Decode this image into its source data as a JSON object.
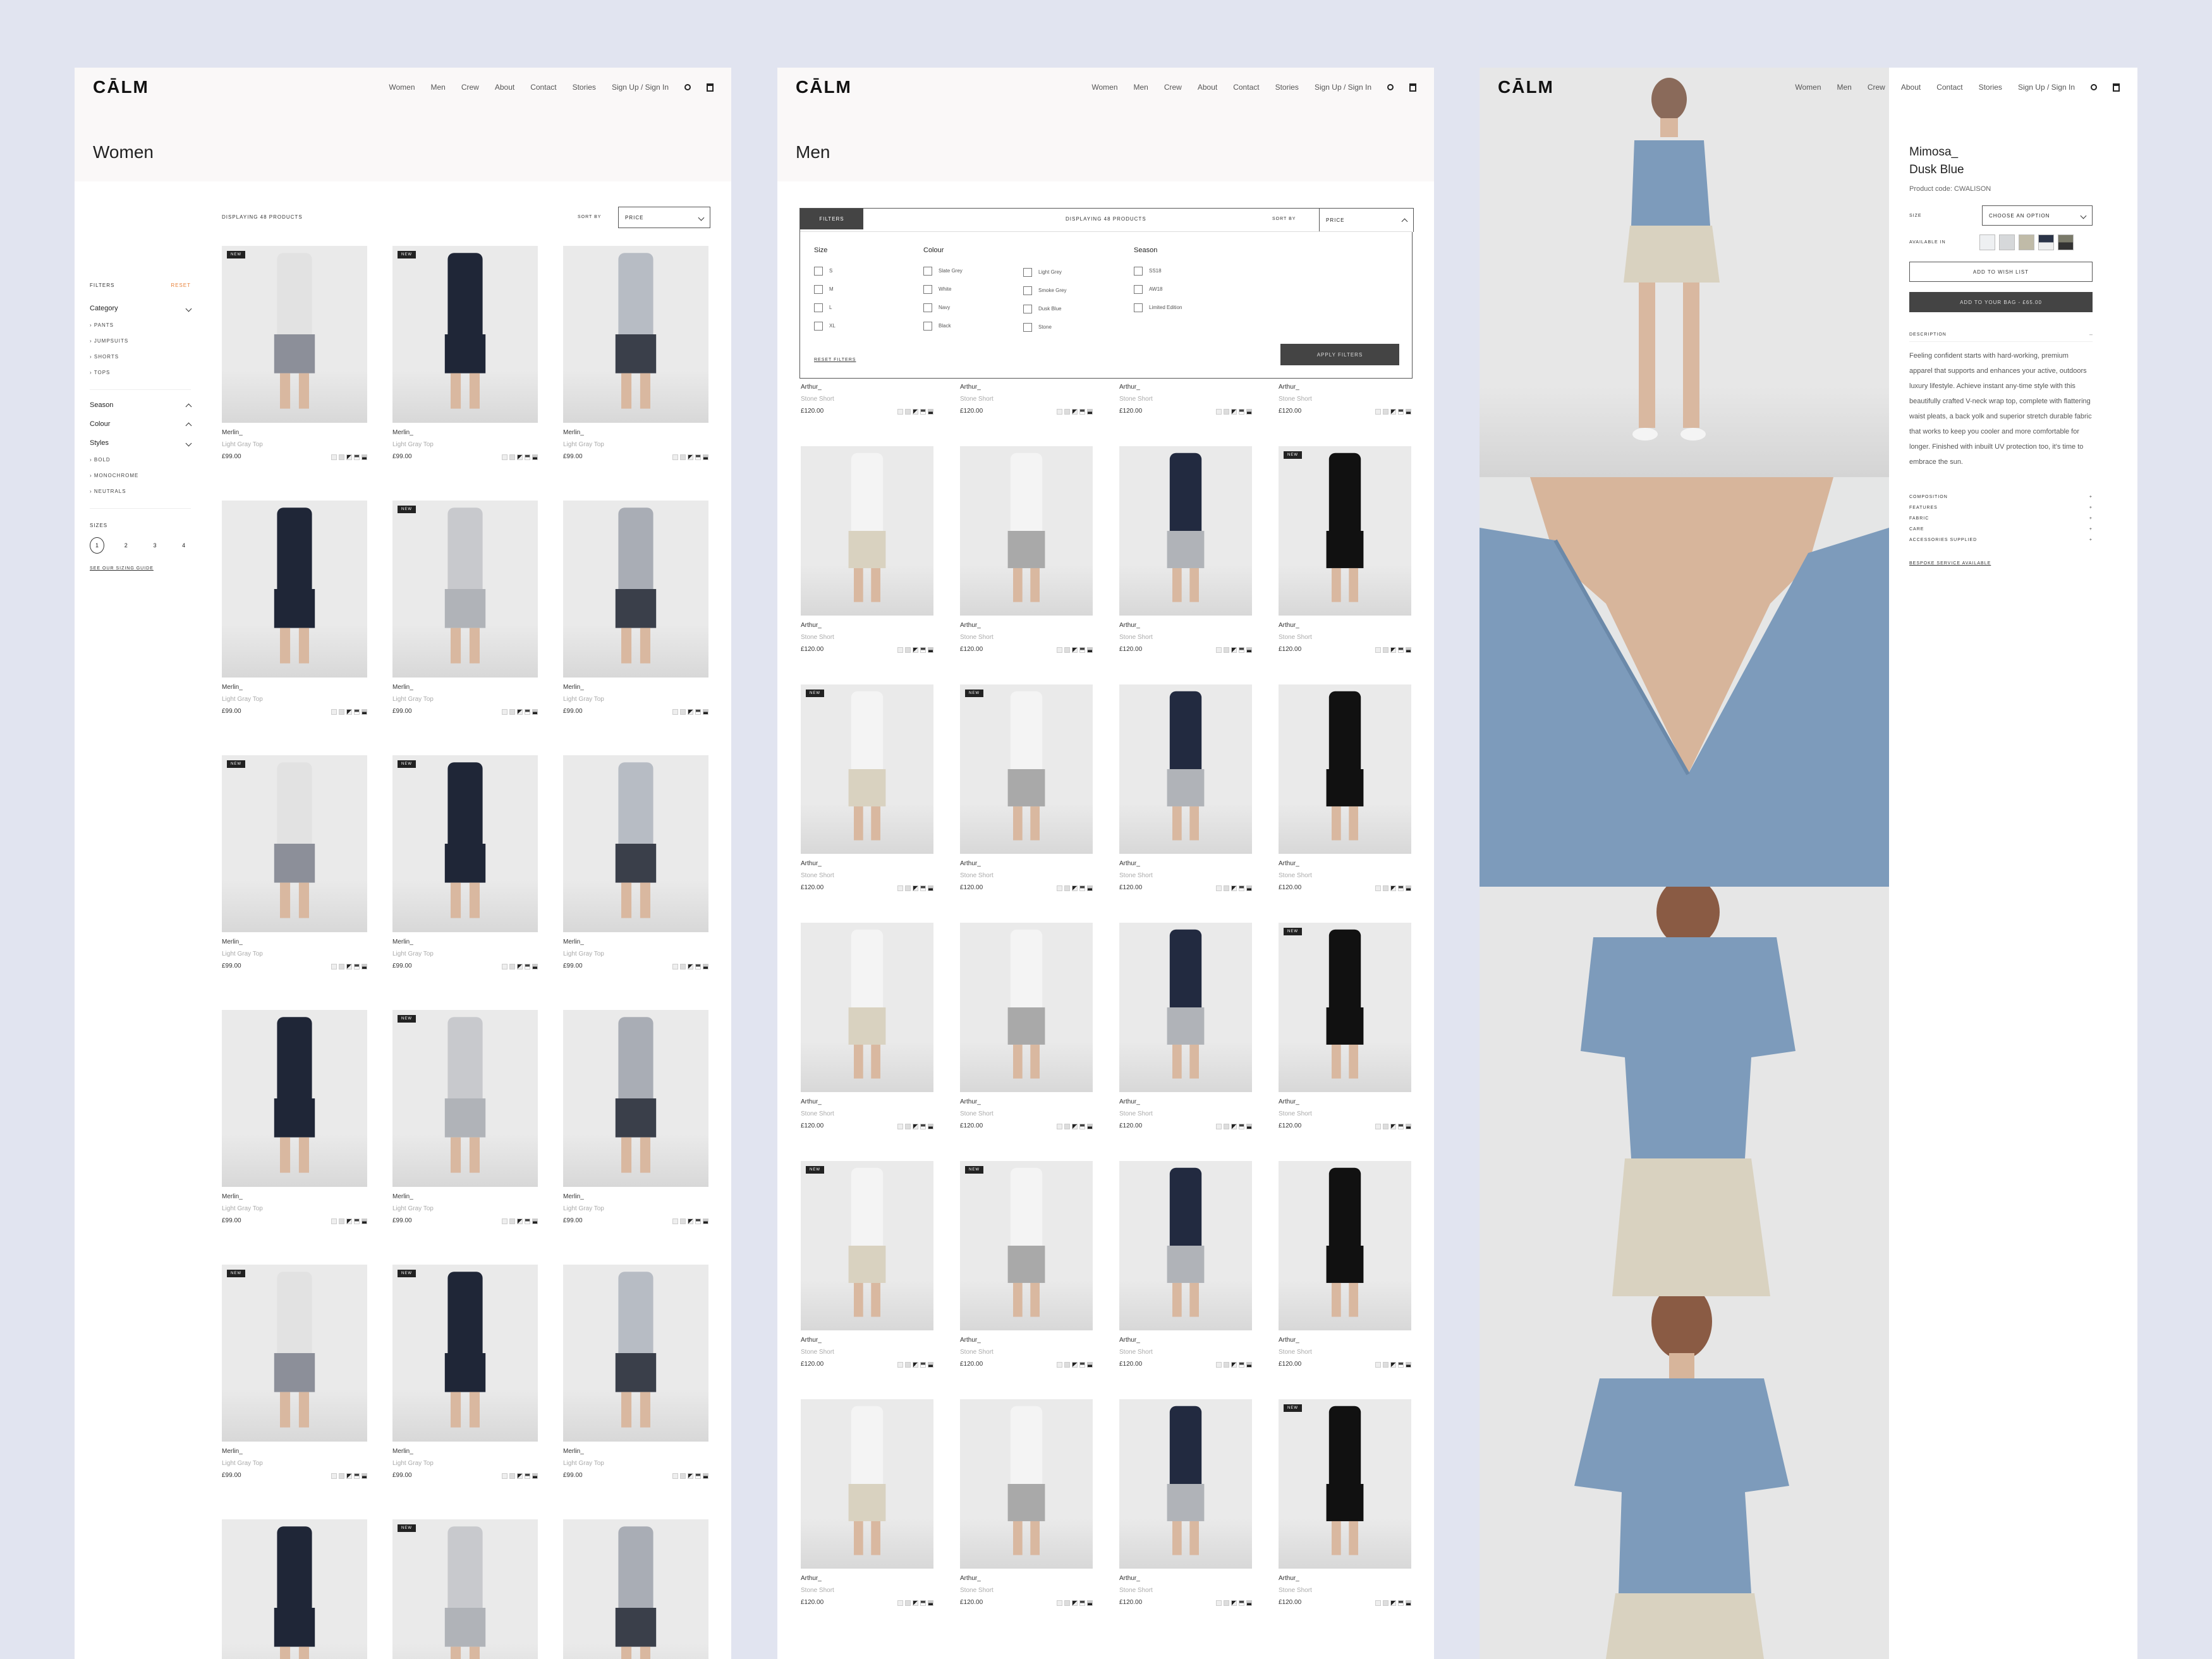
{
  "brand": "CĀLM",
  "nav": [
    "Women",
    "Men",
    "Crew",
    "About",
    "Contact",
    "Stories",
    "Sign Up / Sign In"
  ],
  "women": {
    "title": "Women",
    "filters_label": "FILTERS",
    "reset_label": "RESET",
    "category_label": "Category",
    "categories": [
      "PANTS",
      "JUMPSUITS",
      "SHORTS",
      "TOPS"
    ],
    "season_label": "Season",
    "colour_label": "Colour",
    "styles_label": "Styles",
    "styles": [
      "BOLD",
      "MONOCHROME",
      "NEUTRALS"
    ],
    "sizes_label": "SIZES",
    "sizes": [
      "1",
      "2",
      "3",
      "4"
    ],
    "sizing_guide": "SEE OUR SIZING GUIDE",
    "count_label": "DISPLAYING 48 PRODUCTS",
    "sort_label": "SORT BY",
    "sort_value": "PRICE",
    "products": [
      {
        "name": "Merlin_",
        "sub": "Light Gray Top",
        "price": "£99.00",
        "badge": "NEW"
      },
      {
        "name": "Merlin_",
        "sub": "Light Gray Top",
        "price": "£99.00",
        "badge": "NEW"
      },
      {
        "name": "Merlin_",
        "sub": "Light Gray Top",
        "price": "£99.00",
        "badge": ""
      },
      {
        "name": "Merlin_",
        "sub": "Light Gray Top",
        "price": "£99.00",
        "badge": ""
      },
      {
        "name": "Merlin_",
        "sub": "Light Gray Top",
        "price": "£99.00",
        "badge": "NEW"
      },
      {
        "name": "Merlin_",
        "sub": "Light Gray Top",
        "price": "£99.00",
        "badge": ""
      },
      {
        "name": "Merlin_",
        "sub": "Light Gray Top",
        "price": "£99.00",
        "badge": "NEW"
      },
      {
        "name": "Merlin_",
        "sub": "Light Gray Top",
        "price": "£99.00",
        "badge": "NEW"
      },
      {
        "name": "Merlin_",
        "sub": "Light Gray Top",
        "price": "£99.00",
        "badge": ""
      },
      {
        "name": "Merlin_",
        "sub": "Light Gray Top",
        "price": "£99.00",
        "badge": ""
      },
      {
        "name": "Merlin_",
        "sub": "Light Gray Top",
        "price": "£99.00",
        "badge": "NEW"
      },
      {
        "name": "Merlin_",
        "sub": "Light Gray Top",
        "price": "£99.00",
        "badge": ""
      },
      {
        "name": "Merlin_",
        "sub": "Light Gray Top",
        "price": "£99.00",
        "badge": "NEW"
      },
      {
        "name": "Merlin_",
        "sub": "Light Gray Top",
        "price": "£99.00",
        "badge": "NEW"
      },
      {
        "name": "Merlin_",
        "sub": "Light Gray Top",
        "price": "£99.00",
        "badge": ""
      },
      {
        "name": "",
        "sub": "",
        "price": "",
        "badge": ""
      },
      {
        "name": "",
        "sub": "",
        "price": "",
        "badge": "NEW"
      },
      {
        "name": "",
        "sub": "",
        "price": "",
        "badge": ""
      }
    ]
  },
  "men": {
    "title": "Men",
    "filters_tab": "FILTERS",
    "count_label": "DISPLAYING 48 PRODUCTS",
    "sort_label": "SORT BY",
    "sort_value": "PRICE",
    "size_label": "Size",
    "size_options": [
      "S",
      "M",
      "L",
      "XL"
    ],
    "colour_label": "Colour",
    "colour_options_a": [
      "Slate Grey",
      "White",
      "Navy",
      "Black"
    ],
    "colour_options_b": [
      "Light Grey",
      "Smoke Grey",
      "Dusk Blue",
      "Stone"
    ],
    "season_label": "Season",
    "season_options": [
      "SS18",
      "AW18",
      "Limited Edition"
    ],
    "reset_filters": "RESET FILTERS",
    "apply_filters": "APPLY FILTERS",
    "products": [
      {
        "name": "Arthur_",
        "sub": "Stone Short",
        "price": "£120.00",
        "badge": ""
      },
      {
        "name": "Arthur_",
        "sub": "Stone Short",
        "price": "£120.00",
        "badge": ""
      },
      {
        "name": "Arthur_",
        "sub": "Stone Short",
        "price": "£120.00",
        "badge": ""
      },
      {
        "name": "Arthur_",
        "sub": "Stone Short",
        "price": "£120.00",
        "badge": ""
      },
      {
        "name": "Arthur_",
        "sub": "Stone Short",
        "price": "£120.00",
        "badge": ""
      },
      {
        "name": "Arthur_",
        "sub": "Stone Short",
        "price": "£120.00",
        "badge": ""
      },
      {
        "name": "Arthur_",
        "sub": "Stone Short",
        "price": "£120.00",
        "badge": ""
      },
      {
        "name": "Arthur_",
        "sub": "Stone Short",
        "price": "£120.00",
        "badge": "NEW"
      },
      {
        "name": "Arthur_",
        "sub": "Stone Short",
        "price": "£120.00",
        "badge": "NEW"
      },
      {
        "name": "Arthur_",
        "sub": "Stone Short",
        "price": "£120.00",
        "badge": "NEW"
      },
      {
        "name": "Arthur_",
        "sub": "Stone Short",
        "price": "£120.00",
        "badge": ""
      },
      {
        "name": "Arthur_",
        "sub": "Stone Short",
        "price": "£120.00",
        "badge": ""
      },
      {
        "name": "Arthur_",
        "sub": "Stone Short",
        "price": "£120.00",
        "badge": ""
      },
      {
        "name": "Arthur_",
        "sub": "Stone Short",
        "price": "£120.00",
        "badge": ""
      },
      {
        "name": "Arthur_",
        "sub": "Stone Short",
        "price": "£120.00",
        "badge": ""
      },
      {
        "name": "Arthur_",
        "sub": "Stone Short",
        "price": "£120.00",
        "badge": "NEW"
      },
      {
        "name": "Arthur_",
        "sub": "Stone Short",
        "price": "£120.00",
        "badge": "NEW"
      },
      {
        "name": "Arthur_",
        "sub": "Stone Short",
        "price": "£120.00",
        "badge": "NEW"
      },
      {
        "name": "Arthur_",
        "sub": "Stone Short",
        "price": "£120.00",
        "badge": ""
      },
      {
        "name": "Arthur_",
        "sub": "Stone Short",
        "price": "£120.00",
        "badge": ""
      },
      {
        "name": "Arthur_",
        "sub": "Stone Short",
        "price": "£120.00",
        "badge": ""
      },
      {
        "name": "Arthur_",
        "sub": "Stone Short",
        "price": "£120.00",
        "badge": ""
      },
      {
        "name": "Arthur_",
        "sub": "Stone Short",
        "price": "£120.00",
        "badge": ""
      },
      {
        "name": "Arthur_",
        "sub": "Stone Short",
        "price": "£120.00",
        "badge": "NEW"
      }
    ]
  },
  "product": {
    "name_line1": "Mimosa_",
    "name_line2": "Dusk Blue",
    "code": "Product code: CWALISON",
    "size_label": "SIZE",
    "size_select": "CHOOSE AN OPTION",
    "available_label": "AVAILABLE IN",
    "wish_list": "ADD TO WISH LIST",
    "add_to_bag": "ADD TO YOUR BAG - £65.00",
    "description_label": "DESCRIPTION",
    "description": "Feeling confident starts with hard-working, premium apparel that supports and enhances your active, outdoors luxury lifestyle. Achieve instant any-time style with this beautifully crafted V-neck wrap top, complete with flattering waist pleats, a back yolk and superior stretch durable fabric that works to keep you cooler and more comfortable for longer. Finished with inbuilt UV protection too, it's time to embrace the sun.",
    "accordion": [
      "COMPOSITION",
      "FEATURES",
      "FABRIC",
      "CARE",
      "ACCESSORIES SUPPLIED"
    ],
    "bespoke": "BESPOKE SERVICE AVAILABLE"
  },
  "colors": {
    "page_bg": "#e1e4f0",
    "panel_bg": "#ffffff",
    "header_bg": "#faf8f8",
    "accent_reset": "#e8823a",
    "dark_button": "#444444",
    "dusk_blue": "#7d9bbb",
    "stone": "#d9d2c0"
  },
  "icons": [
    "search-icon",
    "bag-icon",
    "chevron-down-icon",
    "chevron-right-icon"
  ]
}
